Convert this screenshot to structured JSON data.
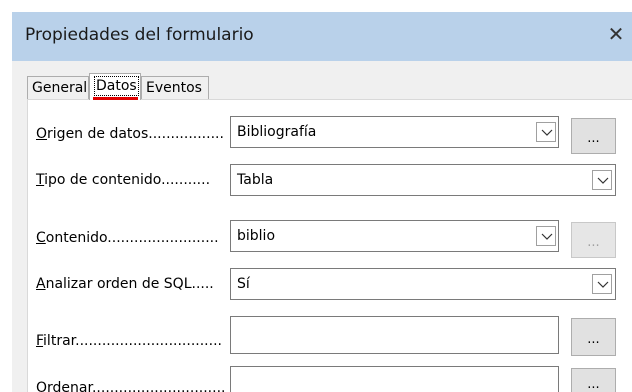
{
  "window": {
    "title": "Propiedades del formulario",
    "close_glyph": "✕"
  },
  "tabs": [
    {
      "label": "General",
      "selected": false
    },
    {
      "label": "Datos",
      "selected": true
    },
    {
      "label": "Eventos",
      "selected": false
    }
  ],
  "fields": {
    "origen": {
      "label_mn": "O",
      "label_rest": "rigen de datos.................",
      "value": "Bibliografía",
      "button": "..."
    },
    "tipo": {
      "label_mn": "T",
      "label_rest": "ipo de contenido...........",
      "value": "Tabla"
    },
    "contenido": {
      "label_mn": "C",
      "label_rest": "ontenido.........................",
      "value": "biblio",
      "button": "..."
    },
    "analizar": {
      "label_mn": "A",
      "label_rest": "nalizar orden de SQL.....",
      "value": "Sí"
    },
    "filtrar": {
      "label_mn": "F",
      "label_rest": "iltrar.................................",
      "value": "",
      "button": "..."
    },
    "ordenar": {
      "label_mn": "O",
      "label_rest": "rdenar..............................",
      "value": "",
      "button": "..."
    }
  },
  "colors": {
    "titlebar": "#b9d1ea",
    "selected_tab_indicator": "#e00000"
  }
}
